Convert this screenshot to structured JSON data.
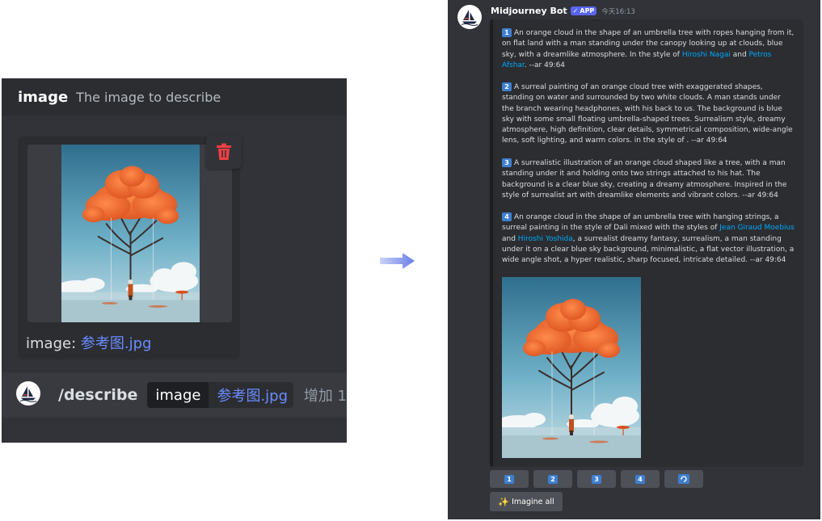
{
  "colors": {
    "discord_bg": "#313338",
    "discord_header": "#2b2d31",
    "accent": "#5865f2",
    "link": "#00a8fc",
    "file_link": "#6a8cff",
    "trash_red": "#f23f42",
    "number_badge": "#3e7fcf",
    "cloud": "#f06a2c",
    "sky": "#4f93ad"
  },
  "describe_panel": {
    "option_name": "image",
    "option_description": "The image to describe",
    "attachment_prefix": "image: ",
    "attachment_filename": "参考图.jpg",
    "trash_icon": "trash-icon",
    "command": "/describe",
    "param_key": "image",
    "param_value": "参考图.jpg",
    "more_params": "增加 1"
  },
  "arrow_icon": "arrow-right-icon",
  "bot_message": {
    "author": "Midjourney Bot",
    "badge_check": "✓",
    "badge": "APP",
    "timestamp": "今天16:13",
    "prompts": [
      {
        "number": "1",
        "text_a": "An orange cloud in the shape of an umbrella tree with ropes hanging from it, on flat land with a man standing under the canopy looking up at clouds, blue sky, with a dreamlike atmosphere. In the style of ",
        "link_1": "Hiroshi Nagai",
        "text_b": " and ",
        "link_2": "Petros Afshar",
        "text_c": ". --ar 49:64"
      },
      {
        "number": "2",
        "text": "A surreal painting of an orange cloud tree with exaggerated shapes, standing on water and surrounded by two white clouds. A man stands under the branch wearing headphones, with his back to us. The background is blue sky with some small floating umbrella-shaped trees. Surrealism style, dreamy atmosphere, high definition, clear details, symmetrical composition, wide-angle lens, soft lighting, and warm colors. in the style of . --ar 49:64"
      },
      {
        "number": "3",
        "text": "A surrealistic illustration of an orange cloud shaped like a tree, with a man standing under it and holding onto two strings attached to his hat. The background is a clear blue sky, creating a dreamy atmosphere. Inspired in the style of surrealist art with dreamlike elements and vibrant colors. --ar 49:64"
      },
      {
        "number": "4",
        "text_a": "An orange cloud in the shape of an umbrella tree with hanging strings, a surreal painting in the style of Dali mixed with the styles of ",
        "link_1": "Jean Giraud Moebius",
        "text_b": " and ",
        "link_2": "Hiroshi Yoshida",
        "text_c": ", a surrealist dreamy fantasy, surrealism, a man standing under it on a clear blue sky background, minimalistic, a flat vector illustration, a wide angle shot, a hyper realistic, sharp focused, intricate detailed. --ar 49:64"
      }
    ],
    "buttons": [
      "1",
      "2",
      "3",
      "4"
    ],
    "refresh_icon": "refresh-icon",
    "imagine_all": "Imagine all",
    "imagine_icon": "magic-wand-icon"
  }
}
